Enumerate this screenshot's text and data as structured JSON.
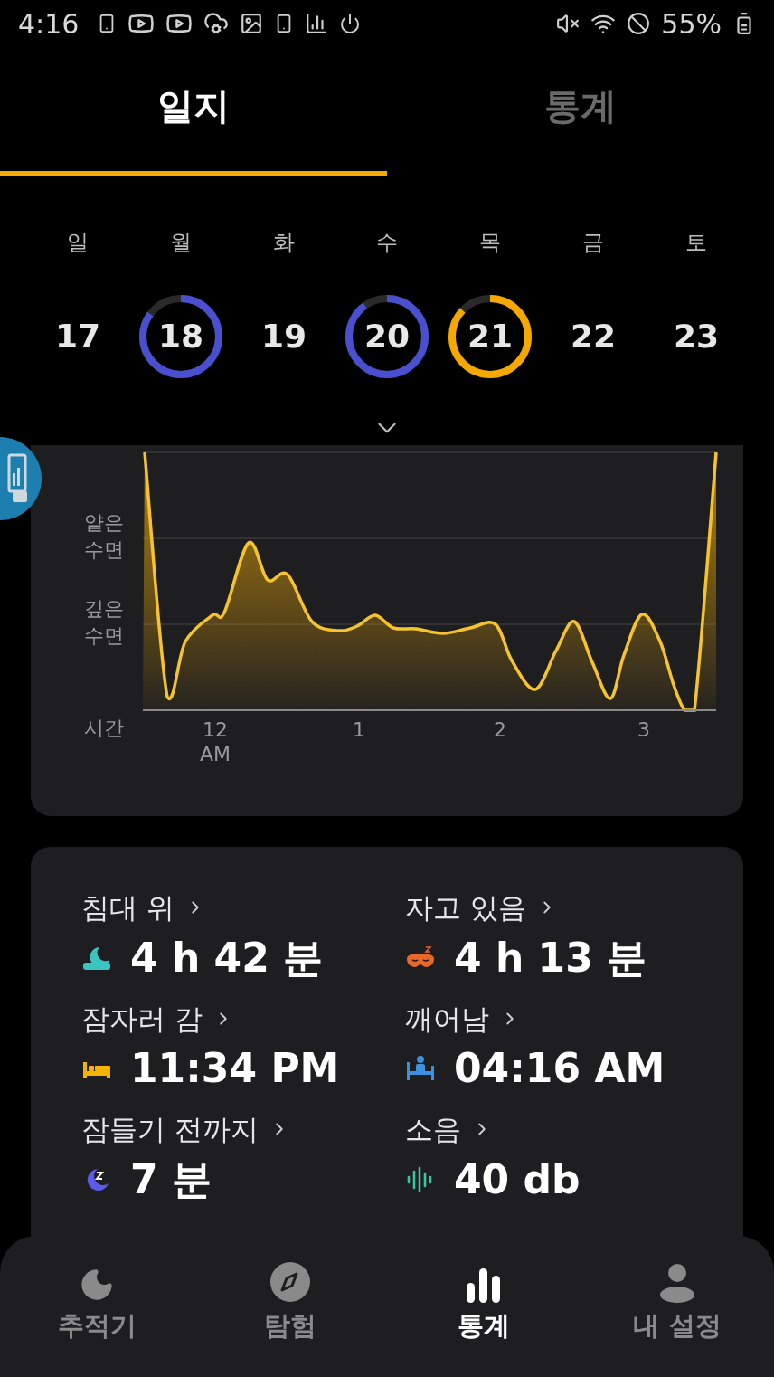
{
  "status_bar": {
    "time": "4:16",
    "battery": "55%"
  },
  "tabs": [
    {
      "label": "일지",
      "selected": true
    },
    {
      "label": "통계",
      "selected": false
    }
  ],
  "week": [
    {
      "weekday": "일",
      "date": "17"
    },
    {
      "weekday": "월",
      "date": "18",
      "ring": {
        "level": 0.85,
        "color": "#4a4fd0"
      }
    },
    {
      "weekday": "화",
      "date": "19"
    },
    {
      "weekday": "수",
      "date": "20",
      "ring": {
        "level": 0.9,
        "color": "#4a4fd0"
      }
    },
    {
      "weekday": "목",
      "date": "21",
      "ring": {
        "level": 0.87,
        "color": "#f5a800"
      }
    },
    {
      "weekday": "금",
      "date": "22"
    },
    {
      "weekday": "토",
      "date": "23"
    }
  ],
  "chart": {
    "y_labels": [
      "얕은\n수면",
      "깊은\n수면"
    ],
    "x_axis_title": "시간",
    "x_labels": [
      "12\nAM",
      "1",
      "2",
      "3"
    ]
  },
  "stats": [
    {
      "kind": "in_bed",
      "label": "침대 위",
      "value": "4 h 42 분"
    },
    {
      "kind": "asleep",
      "label": "자고 있음",
      "value": "4 h 13 분"
    },
    {
      "kind": "went_to_bed",
      "label": "잠자러 감",
      "value": "11:34 PM"
    },
    {
      "kind": "woke_up",
      "label": "깨어남",
      "value": "04:16 AM"
    },
    {
      "kind": "fell_asleep",
      "label": "잠들기 전까지",
      "value": "7 분"
    },
    {
      "kind": "noise",
      "label": "소음",
      "value": "40 db"
    }
  ],
  "nav": [
    {
      "kind": "tracker",
      "label": "추적기",
      "selected": false
    },
    {
      "kind": "explore",
      "label": "탐험",
      "selected": false
    },
    {
      "kind": "stats",
      "label": "통계",
      "selected": true
    },
    {
      "kind": "profile",
      "label": "내 설정",
      "selected": false
    }
  ]
}
